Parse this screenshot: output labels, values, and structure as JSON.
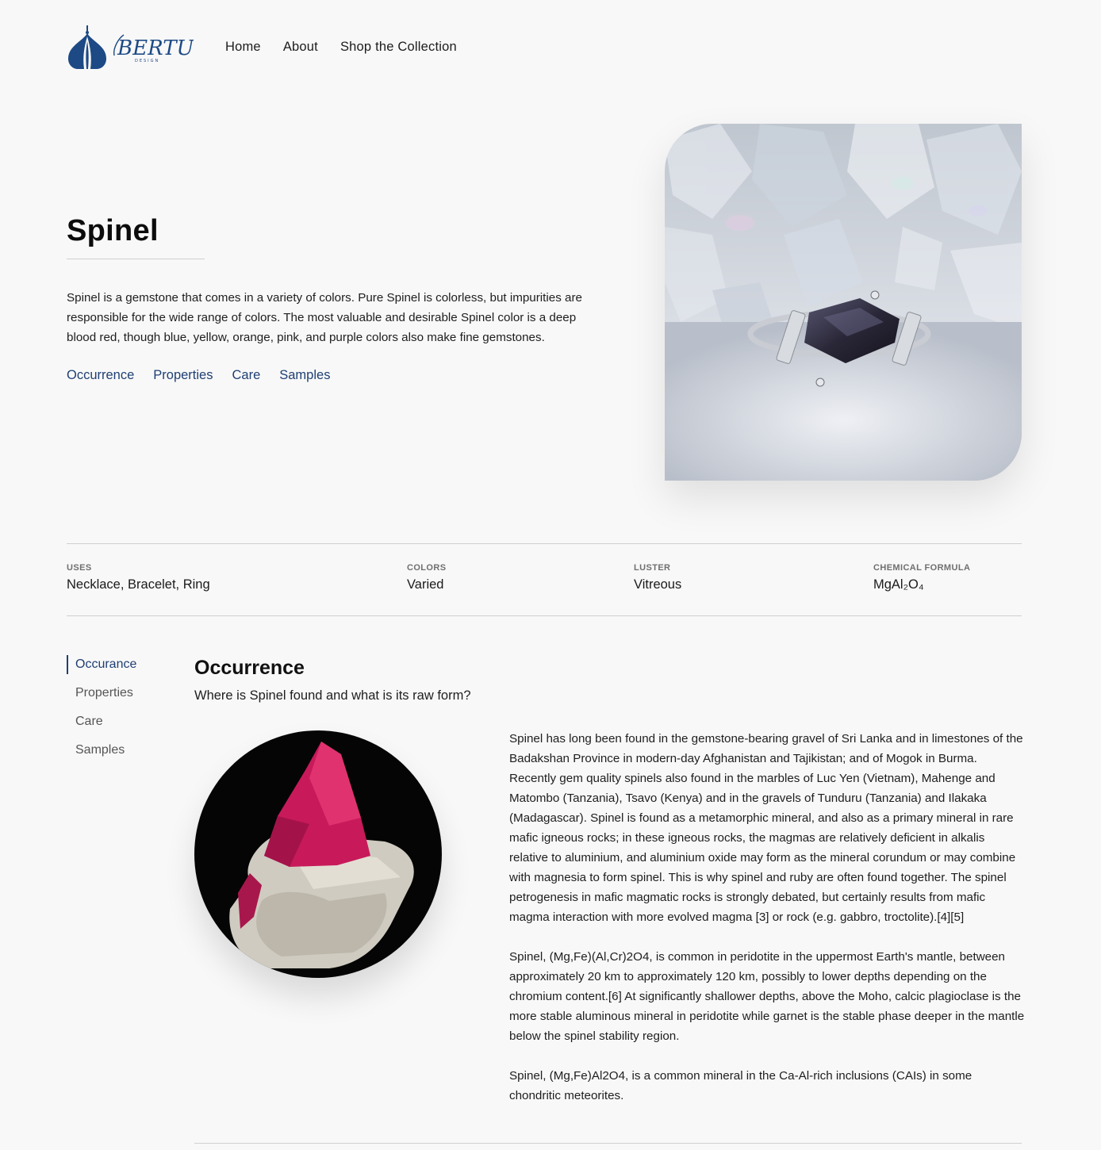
{
  "brand": {
    "logo_text": "BERTUS",
    "logo_subtext": "DESIGN"
  },
  "nav": {
    "items": [
      "Home",
      "About",
      "Shop the Collection"
    ]
  },
  "hero": {
    "title": "Spinel",
    "description": "Spinel is a gemstone that comes in a variety of colors. Pure Spinel is colorless, but impurities are responsible for the wide range of colors. The most valuable and desirable Spinel color is a deep blood red, though blue, yellow, orange, pink, and purple colors also make fine gemstones.",
    "links": [
      "Occurrence",
      "Properties",
      "Care",
      "Samples"
    ],
    "image_alt": "Dark spinel set in a silver ring"
  },
  "specs": [
    {
      "label": "USES",
      "value": "Necklace, Bracelet, Ring"
    },
    {
      "label": "COLORS",
      "value": "Varied"
    },
    {
      "label": "LUSTER",
      "value": "Vitreous"
    },
    {
      "label": "CHEMICAL FORMULA",
      "value": "MgAl₂O₄"
    }
  ],
  "side_nav": {
    "items": [
      "Occurance",
      "Properties",
      "Care",
      "Samples"
    ],
    "active": "Occurance"
  },
  "section": {
    "title": "Occurrence",
    "subtitle": "Where is Spinel found and what is its raw form?",
    "paragraphs": [
      "Spinel has long been found in the gemstone-bearing gravel of Sri Lanka and in limestones of the Badakshan Province in modern-day Afghanistan and Tajikistan; and of Mogok in Burma. Recently gem quality spinels also found in the marbles of Luc Yen (Vietnam), Mahenge and Matombo (Tanzania), Tsavo (Kenya) and in the gravels of Tunduru (Tanzania) and Ilakaka (Madagascar). Spinel is found as a metamorphic mineral, and also as a primary mineral in rare mafic igneous rocks; in these igneous rocks, the magmas are relatively deficient in alkalis relative to aluminium, and aluminium oxide may form as the mineral corundum or may combine with magnesia to form spinel. This is why spinel and ruby are often found together. The spinel petrogenesis in mafic magmatic rocks is strongly debated, but certainly results from mafic magma interaction with more evolved magma [3] or rock (e.g. gabbro, troctolite).[4][5]",
      "Spinel, (Mg,Fe)(Al,Cr)2O4, is common in peridotite in the uppermost Earth's mantle, between approximately 20 km to approximately 120 km, possibly to lower depths depending on the chromium content.[6] At significantly shallower depths, above the Moho, calcic plagioclase is the more stable aluminous mineral in peridotite while garnet is the stable phase deeper in the mantle below the spinel stability region.",
      "Spinel, (Mg,Fe)Al2O4, is a common mineral in the Ca-Al-rich inclusions (CAIs) in some chondritic meteorites."
    ]
  },
  "colors": {
    "brand_blue": "#1f3f73",
    "logo_blue": "#1d4a85",
    "background": "#f8f8f8"
  }
}
